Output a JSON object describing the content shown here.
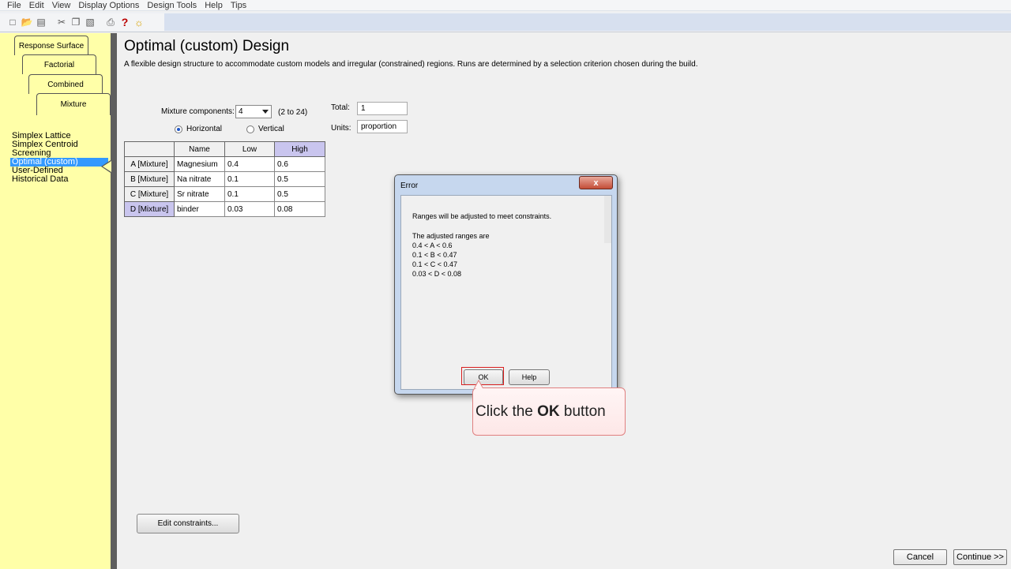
{
  "menu": [
    "File",
    "Edit",
    "View",
    "Display Options",
    "Design Tools",
    "Help",
    "Tips"
  ],
  "toolbar_icons": [
    "new-file-icon",
    "open-folder-icon",
    "save-icon",
    "cut-icon",
    "copy-icon",
    "paste-icon",
    "print-icon",
    "help-icon",
    "tip-bulb-icon"
  ],
  "tabs": {
    "response_surface": "Response Surface",
    "factorial": "Factorial",
    "combined": "Combined",
    "mixture": "Mixture"
  },
  "nav": [
    "Simplex Lattice",
    "Simplex Centroid",
    "Screening",
    "Optimal (custom)",
    "User-Defined",
    "Historical Data"
  ],
  "nav_selected": "Optimal (custom)",
  "page": {
    "title": "Optimal (custom) Design",
    "description": "A flexible design structure to accommodate custom models and irregular (constrained) regions.  Runs are determined by a selection criterion chosen during the build."
  },
  "form": {
    "components_label": "Mixture components:",
    "components_value": "4",
    "components_range": "(2 to 24)",
    "total_label": "Total:",
    "total_value": "1",
    "units_label": "Units:",
    "units_value": "proportion",
    "horizontal_label": "Horizontal",
    "vertical_label": "Vertical",
    "orientation_selected": "Horizontal"
  },
  "table": {
    "headers": [
      "Name",
      "Low",
      "High"
    ],
    "rows": [
      {
        "label": "A [Mixture]",
        "name": "Magnesium",
        "low": "0.4",
        "high": "0.6"
      },
      {
        "label": "B [Mixture]",
        "name": "Na nitrate",
        "low": "0.1",
        "high": "0.5"
      },
      {
        "label": "C [Mixture]",
        "name": "Sr nitrate",
        "low": "0.1",
        "high": "0.5"
      },
      {
        "label": "D [Mixture]",
        "name": "binder",
        "low": "0.03",
        "high": "0.08"
      }
    ]
  },
  "edit_constraints_label": "Edit constraints...",
  "cancel_label": "Cancel",
  "continue_label": "Continue >>",
  "dialog": {
    "title": "Error",
    "close_label": "x",
    "line1": "Ranges will be adjusted to meet constraints.",
    "line2": "The adjusted ranges are",
    "ranges": [
      "0.4 < A < 0.6",
      "0.1 < B < 0.47",
      "0.1 < C < 0.47",
      "0.03 < D < 0.08"
    ],
    "ok_label": "OK",
    "help_label": "Help"
  },
  "callout": {
    "pre": "Click the ",
    "bold": "OK",
    "post": " button"
  }
}
